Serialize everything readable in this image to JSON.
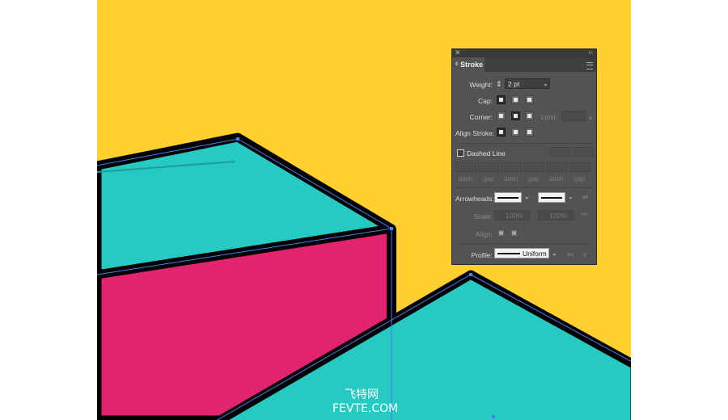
{
  "colors": {
    "background": "#ffd02f",
    "cyan": "#25cbc3",
    "magenta": "#e42370",
    "stroke": "#000000",
    "selection": "#4a7df0",
    "panel": "#535353"
  },
  "panel": {
    "title": "Stroke",
    "weight_label": "Weight:",
    "weight_value": "2 pt",
    "cap_label": "Cap:",
    "corner_label": "Corner:",
    "limit_label": "Limit:",
    "limit_suffix": "x",
    "align_stroke_label": "Align Stroke:",
    "dashed_line_label": "Dashed Line",
    "dash_labels": [
      "dash",
      "gap",
      "dash",
      "gap",
      "dash",
      "gap"
    ],
    "arrowheads_label": "Arrowheads:",
    "scale_label": "Scale:",
    "scale_value_1": "100%",
    "scale_value_2": "100%",
    "align_label": "Align:",
    "profile_label": "Profile:",
    "profile_value": "Uniform"
  },
  "watermark": {
    "line1": "飞特网",
    "line2": "FEVTE.COM"
  }
}
